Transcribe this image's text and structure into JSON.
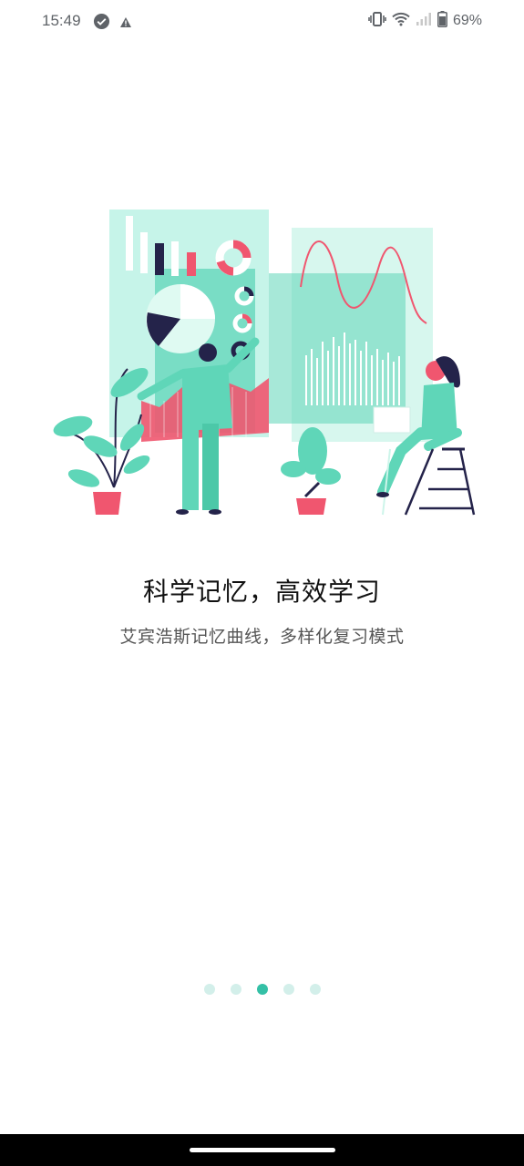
{
  "status_bar": {
    "time": "15:49",
    "battery_percent": "69%",
    "icons": [
      "check-circle-icon",
      "alert-triangle-icon",
      "vibrate-icon",
      "wifi-icon",
      "cell-signal-icon",
      "battery-icon"
    ]
  },
  "onboarding": {
    "title": "科学记忆，高效学习",
    "subtitle": "艾宾浩斯记忆曲线，多样化复习模式",
    "page_count": 5,
    "active_page": 3
  },
  "colors": {
    "accent": "#34c0a6",
    "dot_inactive": "#d3efea",
    "illus_mint": "#5fd6b8",
    "illus_pink": "#f0566f",
    "illus_navy": "#24234a"
  }
}
